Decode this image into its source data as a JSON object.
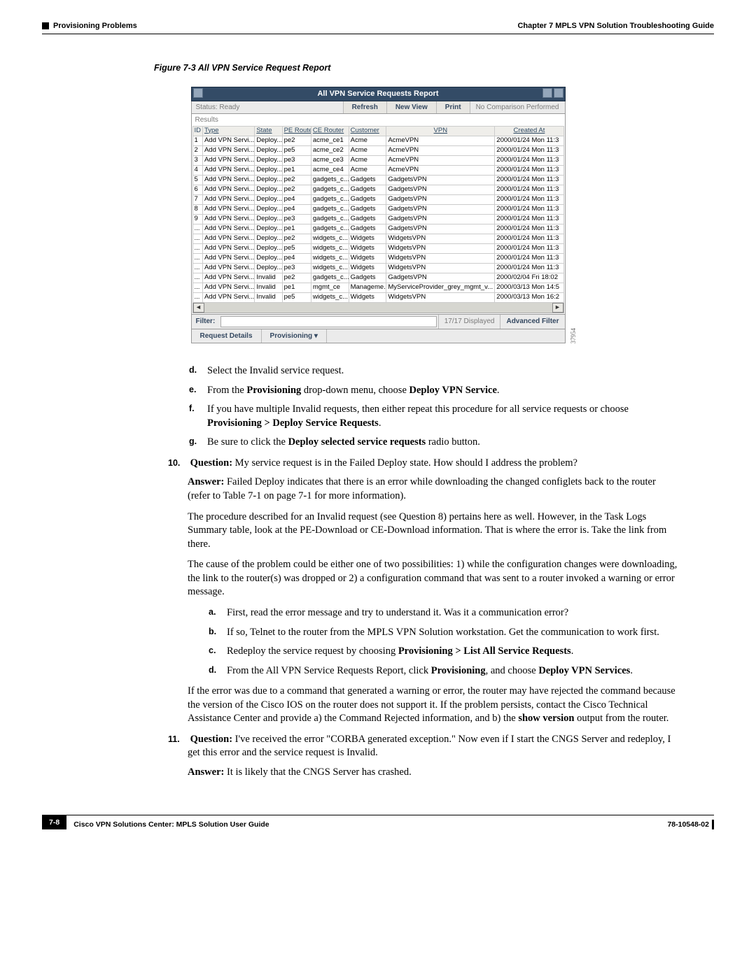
{
  "header": {
    "chapter": "Chapter 7    MPLS VPN Solution Troubleshooting Guide",
    "section": "Provisioning Problems"
  },
  "figure": {
    "caption": "Figure 7-3    All VPN Service Request Report"
  },
  "app": {
    "title": "All VPN Service Requests Report",
    "status_label": "Status:",
    "status_value": "Ready",
    "refresh": "Refresh",
    "new_view": "New View",
    "print": "Print",
    "no_compare": "No Comparison Performed",
    "results_label": "Results",
    "columns": {
      "id": "ID",
      "type": "Type",
      "state": "State",
      "pe": "PE Router",
      "ce": "CE Router",
      "customer": "Customer",
      "vpn": "VPN",
      "created": "Created At"
    },
    "rows": [
      {
        "id": "1",
        "type": "Add VPN Servi...",
        "state": "Deploy...",
        "pe": "pe2",
        "ce": "acme_ce1",
        "cust": "Acme",
        "vpn": "AcmeVPN",
        "created": "2000/01/24 Mon 11:3"
      },
      {
        "id": "2",
        "type": "Add VPN Servi...",
        "state": "Deploy...",
        "pe": "pe5",
        "ce": "acme_ce2",
        "cust": "Acme",
        "vpn": "AcmeVPN",
        "created": "2000/01/24 Mon 11:3"
      },
      {
        "id": "3",
        "type": "Add VPN Servi...",
        "state": "Deploy...",
        "pe": "pe3",
        "ce": "acme_ce3",
        "cust": "Acme",
        "vpn": "AcmeVPN",
        "created": "2000/01/24 Mon 11:3"
      },
      {
        "id": "4",
        "type": "Add VPN Servi...",
        "state": "Deploy...",
        "pe": "pe1",
        "ce": "acme_ce4",
        "cust": "Acme",
        "vpn": "AcmeVPN",
        "created": "2000/01/24 Mon 11:3"
      },
      {
        "id": "5",
        "type": "Add VPN Servi...",
        "state": "Deploy...",
        "pe": "pe2",
        "ce": "gadgets_c...",
        "cust": "Gadgets",
        "vpn": "GadgetsVPN",
        "created": "2000/01/24 Mon 11:3"
      },
      {
        "id": "6",
        "type": "Add VPN Servi...",
        "state": "Deploy...",
        "pe": "pe2",
        "ce": "gadgets_c...",
        "cust": "Gadgets",
        "vpn": "GadgetsVPN",
        "created": "2000/01/24 Mon 11:3"
      },
      {
        "id": "7",
        "type": "Add VPN Servi...",
        "state": "Deploy...",
        "pe": "pe4",
        "ce": "gadgets_c...",
        "cust": "Gadgets",
        "vpn": "GadgetsVPN",
        "created": "2000/01/24 Mon 11:3"
      },
      {
        "id": "8",
        "type": "Add VPN Servi...",
        "state": "Deploy...",
        "pe": "pe4",
        "ce": "gadgets_c...",
        "cust": "Gadgets",
        "vpn": "GadgetsVPN",
        "created": "2000/01/24 Mon 11:3"
      },
      {
        "id": "9",
        "type": "Add VPN Servi...",
        "state": "Deploy...",
        "pe": "pe3",
        "ce": "gadgets_c...",
        "cust": "Gadgets",
        "vpn": "GadgetsVPN",
        "created": "2000/01/24 Mon 11:3"
      },
      {
        "id": "...",
        "type": "Add VPN Servi...",
        "state": "Deploy...",
        "pe": "pe1",
        "ce": "gadgets_c...",
        "cust": "Gadgets",
        "vpn": "GadgetsVPN",
        "created": "2000/01/24 Mon 11:3"
      },
      {
        "id": "...",
        "type": "Add VPN Servi...",
        "state": "Deploy...",
        "pe": "pe2",
        "ce": "widgets_c...",
        "cust": "Widgets",
        "vpn": "WidgetsVPN",
        "created": "2000/01/24 Mon 11:3"
      },
      {
        "id": "...",
        "type": "Add VPN Servi...",
        "state": "Deploy...",
        "pe": "pe5",
        "ce": "widgets_c...",
        "cust": "Widgets",
        "vpn": "WidgetsVPN",
        "created": "2000/01/24 Mon 11:3"
      },
      {
        "id": "...",
        "type": "Add VPN Servi...",
        "state": "Deploy...",
        "pe": "pe4",
        "ce": "widgets_c...",
        "cust": "Widgets",
        "vpn": "WidgetsVPN",
        "created": "2000/01/24 Mon 11:3"
      },
      {
        "id": "...",
        "type": "Add VPN Servi...",
        "state": "Deploy...",
        "pe": "pe3",
        "ce": "widgets_c...",
        "cust": "Widgets",
        "vpn": "WidgetsVPN",
        "created": "2000/01/24 Mon 11:3"
      },
      {
        "id": "...",
        "type": "Add VPN Servi...",
        "state": "Invalid",
        "pe": "pe2",
        "ce": "gadgets_c...",
        "cust": "Gadgets",
        "vpn": "GadgetsVPN",
        "created": "2000/02/04 Fri 18:02"
      },
      {
        "id": "...",
        "type": "Add VPN Servi...",
        "state": "Invalid",
        "pe": "pe1",
        "ce": "mgmt_ce",
        "cust": "Manageme...",
        "vpn": "MyServiceProvider_grey_mgmt_v...",
        "created": "2000/03/13 Mon 14:5"
      },
      {
        "id": "...",
        "type": "Add VPN Servi...",
        "state": "Invalid",
        "pe": "pe5",
        "ce": "widgets_c...",
        "cust": "Widgets",
        "vpn": "WidgetsVPN",
        "created": "2000/03/13 Mon 16:2"
      }
    ],
    "filter_label": "Filter:",
    "displayed": "17/17 Displayed",
    "adv_filter": "Advanced Filter",
    "req_details": "Request Details",
    "provisioning": "Provisioning ▾",
    "side_num": "37954"
  },
  "steps_top": {
    "d": "Select the Invalid service request.",
    "e_pre": "From the ",
    "e_b1": "Provisioning",
    "e_mid": " drop-down menu, choose ",
    "e_b2": "Deploy VPN Service",
    "e_post": ".",
    "f_pre": "If you have multiple Invalid requests, then either repeat this procedure for all service requests or choose ",
    "f_b": "Provisioning > Deploy Service Requests",
    "f_post": ".",
    "g_pre": "Be sure to click the ",
    "g_b": "Deploy selected service requests",
    "g_post": " radio button."
  },
  "q10": {
    "num": "10.",
    "q_label": "Question:",
    "q_text": " My service request is in the Failed Deploy state. How should I address the problem?",
    "a_label": "Answer:",
    "a_text": " Failed Deploy indicates that there is an error while downloading the changed configlets back to the router (refer to Table 7-1 on page 7-1 for more information).",
    "p2": "The procedure described for an Invalid request (see Question 8) pertains here as well. However, in the Task Logs Summary table, look at the PE-Download or CE-Download information. That is where the error is. Take the link from there.",
    "p3": "The cause of the problem could be either one of two possibilities: 1) while the configuration changes were downloading, the link to the router(s) was dropped or 2) a configuration command that was sent to a router invoked a warning or error message.",
    "a": "First, read the error message and try to understand it. Was it a communication error?",
    "b": "If so, Telnet to the router from the MPLS VPN Solution workstation. Get the communication to work first.",
    "c_pre": "Redeploy the service request by choosing ",
    "c_b": "Provisioning > List All Service Requests",
    "c_post": ".",
    "d_pre": "From the All VPN Service Requests Report, click ",
    "d_b1": "Provisioning",
    "d_mid": ", and choose ",
    "d_b2": "Deploy VPN Services",
    "d_post": ".",
    "p4_pre": "If the error was due to a command that generated a warning or error, the router may have rejected the command because the version of the Cisco IOS on the router does not support it. If the problem persists, contact the Cisco Technical Assistance Center and provide a) the Command Rejected information, and b) the ",
    "p4_b": "show version",
    "p4_post": " output from the router."
  },
  "q11": {
    "num": "11.",
    "q_label": "Question:",
    "q_text": " I've received the error \"CORBA generated exception.\" Now even if I start the CNGS Server and redeploy, I get this error and the service request is Invalid.",
    "a_label": "Answer:",
    "a_text": " It is likely that the CNGS Server has crashed."
  },
  "footer": {
    "title": "Cisco VPN Solutions Center: MPLS Solution User Guide",
    "page": "7-8",
    "docnum": "78-10548-02"
  }
}
